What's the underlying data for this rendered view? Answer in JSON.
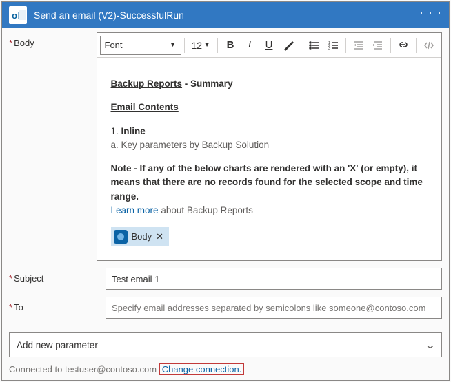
{
  "header": {
    "title": "Send an email (V2)-SuccessfulRun"
  },
  "labels": {
    "body": "Body",
    "subject": "Subject",
    "to": "To"
  },
  "toolbar": {
    "font": "Font",
    "size": "12"
  },
  "editor": {
    "section_title_a": "Backup Reports",
    "section_title_b": " - Summary",
    "section_sub": "Email Contents",
    "l1": "1. ",
    "l1b": "Inline",
    "l2": "a. Key parameters by Backup Solution",
    "note_label": "Note",
    "note_text": " - If any of the below charts are rendered with an 'X' (or empty), it means that there are no records found for the selected scope and time range.",
    "learn": "Learn more",
    "learn_rest": " about Backup Reports",
    "chip_label": "Body"
  },
  "subject": {
    "value": "Test email 1"
  },
  "to": {
    "placeholder": "Specify email addresses separated by semicolons like someone@contoso.com"
  },
  "addparam": {
    "label": "Add new parameter"
  },
  "footer": {
    "connected": "Connected to testuser@contoso.com ",
    "change": "Change connection."
  }
}
